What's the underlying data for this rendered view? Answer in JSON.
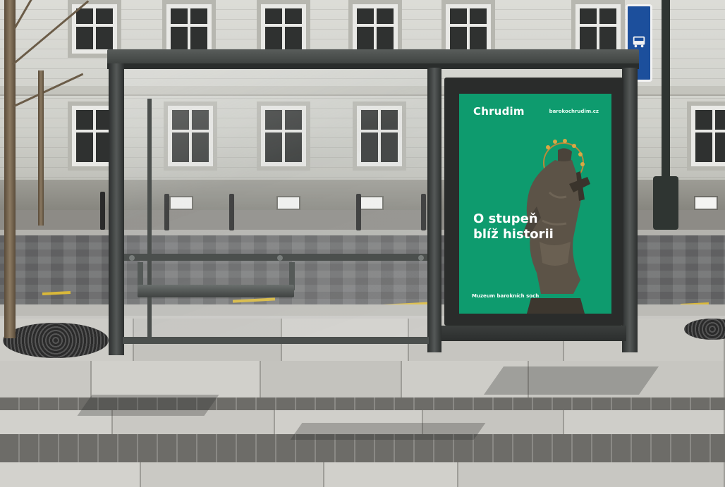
{
  "scene": {
    "description_label": "",
    "colors": {
      "poster_green": "#0e9b6e",
      "bus_sign_blue": "#1c4f9c",
      "shelter_frame": "#3d413f",
      "pavement": "#c8c7c3"
    }
  },
  "poster": {
    "brand": "Chrudim",
    "url": "barokochrudim.cz",
    "headline_line1": "O stupeň",
    "headline_line2": "blíž historii",
    "footer": "Muzeum barokních soch"
  },
  "signage": {
    "bus_stop_icon": "bus-icon"
  }
}
